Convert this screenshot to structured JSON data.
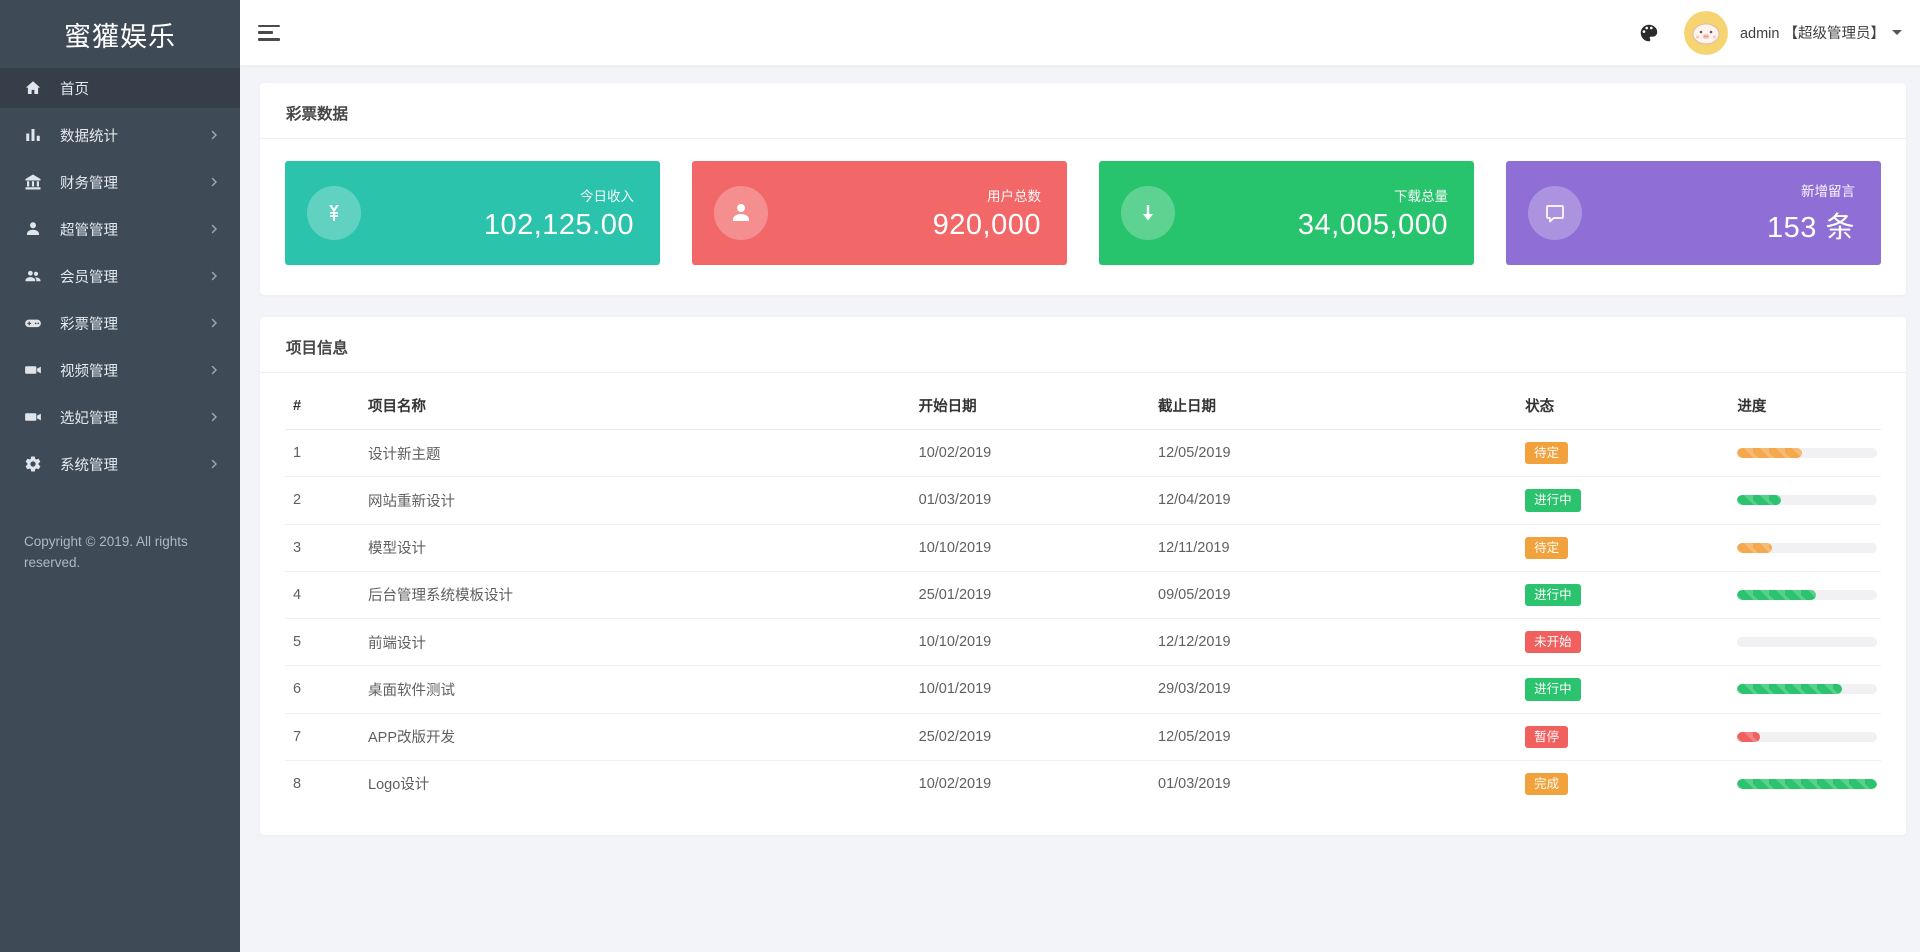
{
  "app": {
    "brand": "蜜獾娱乐",
    "copyright": "Copyright © 2019. All rights reserved."
  },
  "sidebar": {
    "items": [
      {
        "icon": "home-icon",
        "label": "首页",
        "active": true,
        "arrow": false
      },
      {
        "icon": "bar-chart-icon",
        "label": "数据统计",
        "active": false,
        "arrow": true
      },
      {
        "icon": "bank-icon",
        "label": "财务管理",
        "active": false,
        "arrow": true
      },
      {
        "icon": "user-icon",
        "label": "超管管理",
        "active": false,
        "arrow": true
      },
      {
        "icon": "users-icon",
        "label": "会员管理",
        "active": false,
        "arrow": true
      },
      {
        "icon": "gamepad-icon",
        "label": "彩票管理",
        "active": false,
        "arrow": true
      },
      {
        "icon": "video-icon",
        "label": "视频管理",
        "active": false,
        "arrow": true
      },
      {
        "icon": "video-icon",
        "label": "选妃管理",
        "active": false,
        "arrow": true
      },
      {
        "icon": "gear-icon",
        "label": "系统管理",
        "active": false,
        "arrow": true
      }
    ]
  },
  "header": {
    "user": "admin 【超级管理员】"
  },
  "stats": {
    "section_title": "彩票数据",
    "cards": [
      {
        "icon": "yen-icon",
        "label": "今日收入",
        "value": "102,125.00",
        "color": "#2cc3ac"
      },
      {
        "icon": "user-icon",
        "label": "用户总数",
        "value": "920,000",
        "color": "#f26868"
      },
      {
        "icon": "download-icon",
        "label": "下载总量",
        "value": "34,005,000",
        "color": "#28c36d"
      },
      {
        "icon": "chat-icon",
        "label": "新增留言",
        "value": "153 条",
        "color": "#8f6fd6"
      }
    ]
  },
  "projects": {
    "section_title": "项目信息",
    "columns": [
      "#",
      "项目名称",
      "开始日期",
      "截止日期",
      "状态",
      "进度"
    ],
    "rows": [
      {
        "num": "1",
        "name": "设计新主题",
        "start": "10/02/2019",
        "end": "12/05/2019",
        "status": "待定",
        "status_type": "warning",
        "progress_pct": 46,
        "progress_type": "warning"
      },
      {
        "num": "2",
        "name": "网站重新设计",
        "start": "01/03/2019",
        "end": "12/04/2019",
        "status": "进行中",
        "status_type": "success",
        "progress_pct": 31,
        "progress_type": "success"
      },
      {
        "num": "3",
        "name": "模型设计",
        "start": "10/10/2019",
        "end": "12/11/2019",
        "status": "待定",
        "status_type": "warning",
        "progress_pct": 25,
        "progress_type": "warning"
      },
      {
        "num": "4",
        "name": "后台管理系统模板设计",
        "start": "25/01/2019",
        "end": "09/05/2019",
        "status": "进行中",
        "status_type": "success",
        "progress_pct": 56,
        "progress_type": "success"
      },
      {
        "num": "5",
        "name": "前端设计",
        "start": "10/10/2019",
        "end": "12/12/2019",
        "status": "未开始",
        "status_type": "danger",
        "progress_pct": 0,
        "progress_type": "danger"
      },
      {
        "num": "6",
        "name": "桌面软件测试",
        "start": "10/01/2019",
        "end": "29/03/2019",
        "status": "进行中",
        "status_type": "success",
        "progress_pct": 75,
        "progress_type": "success"
      },
      {
        "num": "7",
        "name": "APP改版开发",
        "start": "25/02/2019",
        "end": "12/05/2019",
        "status": "暂停",
        "status_type": "danger",
        "progress_pct": 16,
        "progress_type": "danger"
      },
      {
        "num": "8",
        "name": "Logo设计",
        "start": "10/02/2019",
        "end": "01/03/2019",
        "status": "完成",
        "status_type": "warning",
        "progress_pct": 100,
        "progress_type": "success"
      }
    ]
  }
}
